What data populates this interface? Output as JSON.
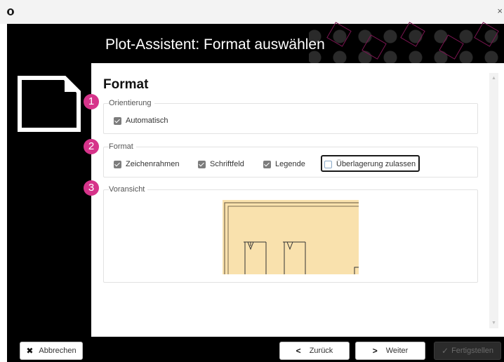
{
  "window": {
    "close_glyph": "×"
  },
  "header": {
    "title": "Plot-Assistent: Format auswählen"
  },
  "page": {
    "title": "Format"
  },
  "sections": {
    "orientation": {
      "badge": "1",
      "label": "Orientierung",
      "options": [
        {
          "label": "Automatisch",
          "checked": true
        }
      ]
    },
    "format": {
      "badge": "2",
      "label": "Format",
      "options": [
        {
          "label": "Zeichenrahmen",
          "checked": true
        },
        {
          "label": "Schriftfeld",
          "checked": true
        },
        {
          "label": "Legende",
          "checked": true
        },
        {
          "label": "Überlagerung zulassen",
          "checked": false,
          "focused": true
        }
      ]
    },
    "preview": {
      "badge": "3",
      "label": "Voransicht"
    }
  },
  "footer": {
    "cancel": {
      "icon": "close-icon",
      "glyph": "✖",
      "label": "Abbrechen"
    },
    "back": {
      "icon": "chevron-left-icon",
      "glyph": "<",
      "label": "Zurück"
    },
    "next": {
      "icon": "chevron-right-icon",
      "glyph": ">",
      "label": "Weiter"
    },
    "finish": {
      "icon": "check-icon",
      "glyph": "✓",
      "label": "Fertigstellen",
      "enabled": false
    }
  },
  "colors": {
    "accent": "#d6338a",
    "frame": "#000000",
    "preview_paper": "#f9e1ad"
  }
}
